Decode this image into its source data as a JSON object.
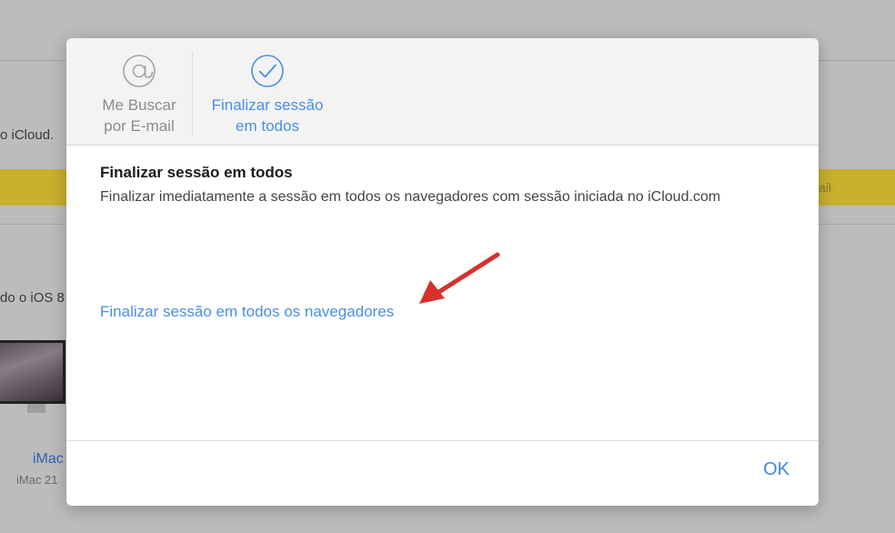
{
  "background": {
    "fragment_icloud": "o iCloud.",
    "fragment_email": "ail",
    "fragment_ios": "do o iOS 8",
    "device_name": "iMac",
    "device_sub": "iMac 21"
  },
  "modal": {
    "tabs": [
      {
        "icon": "at-sign-icon",
        "label_line1": "Me Buscar",
        "label_line2": "por E-mail",
        "selected": false
      },
      {
        "icon": "checkmark-circle-icon",
        "label_line1": "Finalizar sessão",
        "label_line2": "em todos",
        "selected": true
      }
    ],
    "title": "Finalizar sessão em todos",
    "description": "Finalizar imediatamente a sessão em todos os navegadores com sessão iniciada no iCloud.com",
    "link_label": "Finalizar sessão em todos os navegadores",
    "ok_label": "OK"
  },
  "colors": {
    "accent": "#4a8ee6",
    "annotation_arrow": "#d6322c",
    "muted_tab": "#8b8b8b",
    "background_highlight": "#c9b02e"
  }
}
